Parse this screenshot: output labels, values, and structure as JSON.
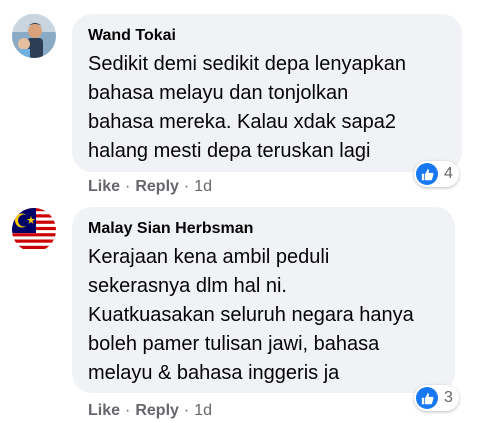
{
  "comments": [
    {
      "author": "Wand Tokai",
      "text": "Sedikit demi sedikit depa lenyapkan\nbahasa melayu dan tonjolkan\nbahasa mereka. Kalau xdak sapa2\nhalang mesti depa teruskan lagi",
      "reaction_count": "4",
      "like_label": "Like",
      "reply_label": "Reply",
      "separator": "·",
      "time": "1d"
    },
    {
      "author": "Malay Sian Herbsman",
      "text": "Kerajaan kena ambil peduli\nsekerasnya dlm hal ni.\nKuatkuasakan seluruh negara hanya\nboleh pamer tulisan jawi, bahasa\nmelayu & bahasa inggeris ja",
      "reaction_count": "3",
      "like_label": "Like",
      "reply_label": "Reply",
      "separator": "·",
      "time": "1d"
    }
  ],
  "icons": {
    "reaction": "like-thumb-icon",
    "avatar_1": "person-photo-avatar",
    "avatar_2": "malaysia-flag-avatar"
  },
  "colors": {
    "bubble": "#f0f2f5",
    "like_blue": "#1877f2",
    "meta_gray": "#65676b",
    "text": "#050505"
  }
}
